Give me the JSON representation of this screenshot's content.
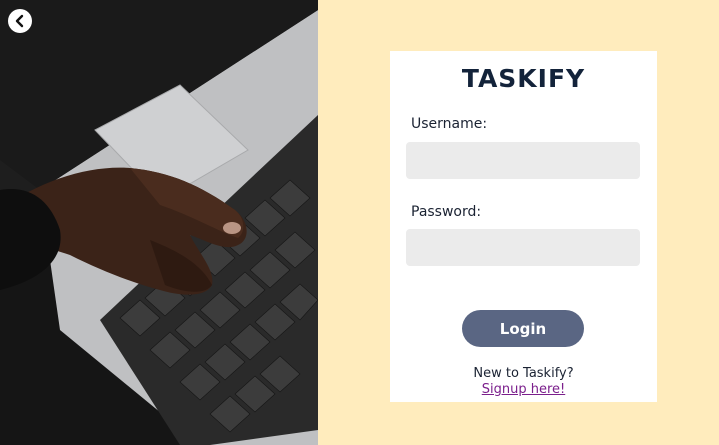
{
  "app": {
    "brand": "TASKIFY"
  },
  "form": {
    "username_label": "Username:",
    "username_value": "",
    "password_label": "Password:",
    "password_value": "",
    "login_label": "Login",
    "new_prompt": "New to Taskify?",
    "signup_label": "Signup here!"
  },
  "icons": {
    "back": "chevron-left-icon"
  },
  "colors": {
    "background": "#ffecbd",
    "card": "#ffffff",
    "field": "#ebebeb",
    "button": "#5a6683",
    "brand_text": "#13233a",
    "link": "#7b1f8c"
  }
}
